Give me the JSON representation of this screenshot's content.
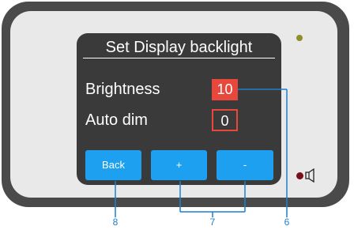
{
  "screen": {
    "title": "Set Display backlight",
    "brightness": {
      "label": "Brightness",
      "value": "10"
    },
    "auto_dim": {
      "label": "Auto dim",
      "value": "0"
    }
  },
  "buttons": {
    "back": "Back",
    "plus": "+",
    "minus": "-"
  },
  "callouts": {
    "back": "8",
    "plus_minus": "7",
    "value": "6"
  },
  "colors": {
    "accent": "#1ea0f0",
    "highlight": "#e8473b",
    "leader": "#1d7fd0",
    "led_olive": "#8e8f2a",
    "led_red": "#7a0f18"
  },
  "icons": [
    "status-led-icon",
    "red-led-icon",
    "speaker-icon"
  ]
}
